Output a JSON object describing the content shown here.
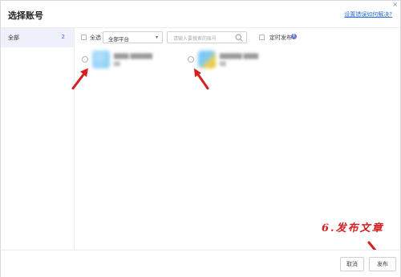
{
  "dialog": {
    "title": "选择账号",
    "help_link": "设置错误如何解决?",
    "close_glyph": "×"
  },
  "sidebar": {
    "items": [
      {
        "label": "全部",
        "count": "2",
        "selected": true
      }
    ]
  },
  "toolbar": {
    "select_all_label": "全选",
    "platform_select": {
      "value": "全部平台",
      "caret": "▾"
    },
    "search": {
      "placeholder": "请输入要搜索的账号",
      "icon": "search-icon"
    },
    "scheduled_label": "定时发布",
    "info_glyph": "i"
  },
  "accounts": [
    {
      "name": "████ ██████",
      "sub": "██",
      "avatar_colors": [
        "#7ec8f5",
        "#b8e2fb"
      ]
    },
    {
      "name": "██████ ████",
      "sub": "██",
      "avatar_colors": [
        "#7ec8f5",
        "#f2d04c"
      ]
    }
  ],
  "footer": {
    "cancel_label": "取消",
    "publish_label": "发布"
  },
  "annotation": {
    "text": "6.发布文章",
    "color": "#d42020"
  }
}
